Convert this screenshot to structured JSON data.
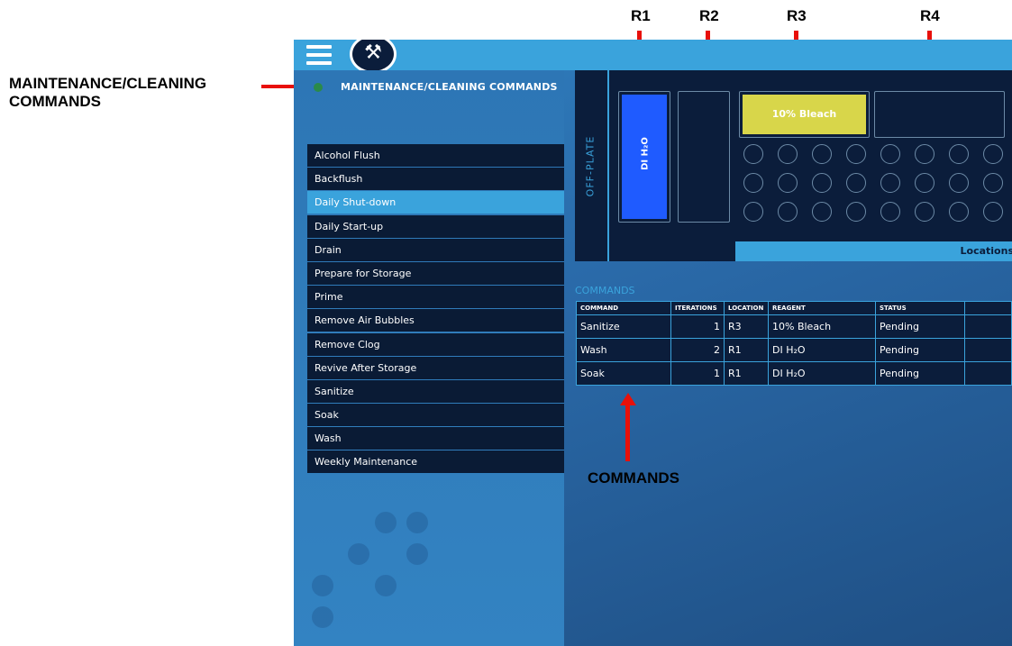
{
  "annotations": {
    "maintenance_label": "MAINTENANCE/CLEANING COMMANDS",
    "r1": "R1",
    "r2": "R2",
    "r3": "R3",
    "r4": "R4",
    "commands": "COMMANDS"
  },
  "sidebar": {
    "title": "MAINTENANCE/CLEANING COMMANDS",
    "items": [
      {
        "label": "Alcohol Flush"
      },
      {
        "label": "Backflush"
      },
      {
        "label": "Daily Shut-down",
        "active": true
      },
      {
        "label": "Daily Start-up"
      },
      {
        "label": "Drain"
      },
      {
        "label": "Prepare for Storage"
      },
      {
        "label": "Prime"
      },
      {
        "label": "Remove Air Bubbles"
      },
      {
        "label": "Remove Clog"
      },
      {
        "label": "Revive After Storage"
      },
      {
        "label": "Sanitize"
      },
      {
        "label": "Soak"
      },
      {
        "label": "Wash"
      },
      {
        "label": "Weekly Maintenance"
      }
    ]
  },
  "plate": {
    "offplate_label": "OFF-PLATE",
    "r1_reagent": "DI H₂O",
    "r3_reagent": "10% Bleach",
    "locations_tab": "Locations"
  },
  "commands": {
    "title": "COMMANDS",
    "headers": [
      "COMMAND",
      "ITERATIONS",
      "LOCATION",
      "REAGENT",
      "STATUS",
      ""
    ],
    "rows": [
      [
        "Sanitize",
        "1",
        "R3",
        "10% Bleach",
        "Pending",
        ""
      ],
      [
        "Wash",
        "2",
        "R1",
        "DI H₂O",
        "Pending",
        ""
      ],
      [
        "Soak",
        "1",
        "R1",
        "DI H₂O",
        "Pending",
        ""
      ]
    ]
  },
  "colors": {
    "accent": "#3aa3dc",
    "dark_panel": "#0b1d3b",
    "reservoir_water": "#1f5bff",
    "reservoir_bleach": "#d8d64a",
    "annotation_arrow": "#e8100a"
  },
  "icons": [
    "menu-icon",
    "tools-icon"
  ]
}
